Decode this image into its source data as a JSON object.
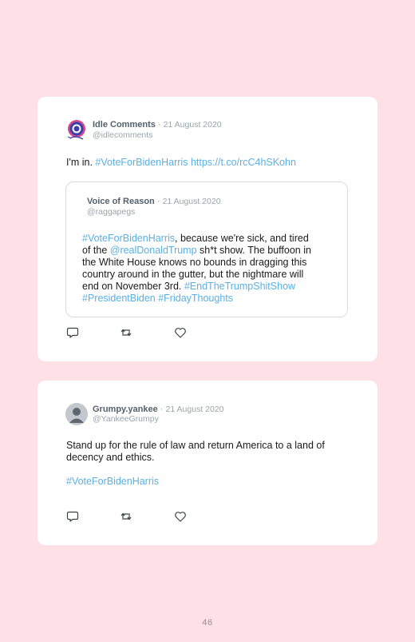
{
  "tweets": [
    {
      "name": "Idle Comments",
      "date": "21 August 2020",
      "handle": "@idlecomments",
      "text_prefix": "I'm in. ",
      "hashtag": "#VoteForBidenHarris",
      "url": "https://t.co/rcC4hSKohn",
      "quoted": {
        "name": "Voice of Reason",
        "date": "21 August 2020",
        "handle": "@raggapegs",
        "lines": [
          [
            {
              "t": "#VoteForBidenHarris",
              "link": true
            },
            {
              "t": ", because we're sick, and tired",
              "link": false
            }
          ],
          [
            {
              "t": "of the ",
              "link": false
            },
            {
              "t": "@realDonaldTrump",
              "link": true
            },
            {
              "t": " sh*t show. The buffoon in",
              "link": false
            }
          ],
          [
            {
              "t": "the White House knows no bounds in dragging this",
              "link": false
            }
          ],
          [
            {
              "t": "country around in the gutter, but the nightmare will",
              "link": false
            }
          ],
          [
            {
              "t": "end on November 3rd. ",
              "link": false
            },
            {
              "t": "#EndTheTrumpShitShow",
              "link": true
            }
          ],
          [
            {
              "t": "#PresidentBiden",
              "link": true
            },
            {
              "t": " ",
              "link": false
            },
            {
              "t": "#FridayThoughts",
              "link": true
            }
          ]
        ]
      }
    },
    {
      "name": "Grumpy.yankee",
      "date": "21 August 2020",
      "handle": "@YankeeGrumpy",
      "text_line1": "Stand up for the rule of law and return America to a land of",
      "text_line2": "decency and ethics.",
      "hashtag": "#VoteForBidenHarris"
    }
  ],
  "separator": "·",
  "icons": [
    "reply-icon",
    "retweet-icon",
    "like-icon"
  ],
  "colors": {
    "background": "#fde1e6",
    "link": "#5bb0e3",
    "name": "#56606b",
    "muted": "#9aa3ab"
  },
  "page_number": "46"
}
